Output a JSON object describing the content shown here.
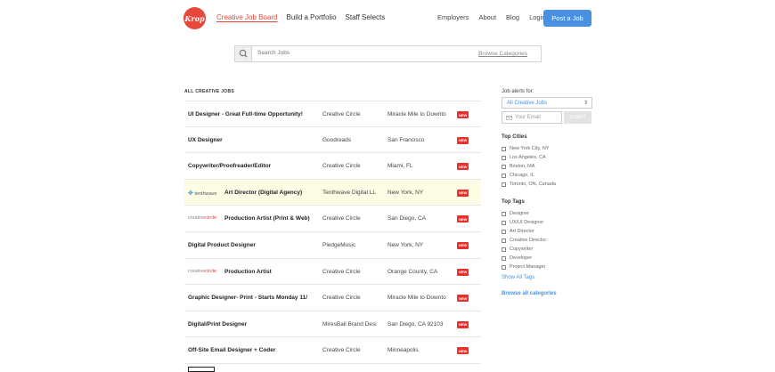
{
  "header": {
    "logo_text": "Krop",
    "nav_left": [
      "Creative Job Board",
      "Build a Portfolio",
      "Staff Selects"
    ],
    "nav_right": [
      "Employers",
      "About",
      "Blog",
      "Login"
    ],
    "post_button": "Post a Job"
  },
  "search": {
    "placeholder": "Search Jobs",
    "browse_label": "Browse Categories"
  },
  "jobs_section_title": "ALL CREATIVE JOBS",
  "jobs": [
    {
      "title": "UI Designer - Great Full-time Opportunity!",
      "company": "Creative Circle",
      "location": "Miracle Mile to Downto",
      "badge": "NEW"
    },
    {
      "title": "UX Designer",
      "company": "Goodreads",
      "location": "San Francisco",
      "badge": "NEW"
    },
    {
      "title": "Copywriter/Proofreader/Editor",
      "company": "Creative Circle",
      "location": "Miami, FL",
      "badge": "NEW"
    },
    {
      "title": "Art Director (Digital Agency)",
      "company": "Tenthwave Digital LL",
      "location": "New York, NY",
      "badge": "NEW",
      "logo": "tenthwave"
    },
    {
      "title": "Production Artist (Print & Web)",
      "company": "Creative Circle",
      "location": "San Diego, CA",
      "badge": "NEW",
      "logo": "creativecircle"
    },
    {
      "title": "Digital Product Designer",
      "company": "PledgeMusic",
      "location": "New York, NY",
      "badge": "NEW"
    },
    {
      "title": "Production Artist",
      "company": "Creative Circle",
      "location": "Orange County, CA",
      "badge": "NEW",
      "logo": "creativecircle"
    },
    {
      "title": "Graphic Designer- Print - Starts Monday 11/",
      "company": "Creative Circle",
      "location": "Miracle Mile to Downto",
      "badge": "NEW"
    },
    {
      "title": "Digital/Print Designer",
      "company": "MiresBall Brand Desi",
      "location": "San Diego, CA 92103",
      "badge": "NEW"
    },
    {
      "title": "Off-Site Email Designer + Coder",
      "company": "Creative Circle",
      "location": "Minneapolis",
      "badge": "NEW"
    }
  ],
  "logos": {
    "tenthwave": "tenthwave",
    "creative": "creative",
    "circle": "circle"
  },
  "sidebar": {
    "alerts_label": "Job alerts for:",
    "alert_select": "All Creative Jobs",
    "email_placeholder": "Your Email",
    "submit_label": "SUBMIT",
    "top_cities_heading": "Top Cities",
    "cities": [
      "New York City, NY",
      "Los Angeles, CA",
      "Boston, MA",
      "Chicago, IL",
      "Toronto, ON, Canada"
    ],
    "top_tags_heading": "Top Tags",
    "tags": [
      "Designer",
      "UX/UI Designer",
      "Art Director",
      "Creative Director",
      "Copywriter",
      "Developer",
      "Project Manager"
    ],
    "show_all_tags": "Show All Tags",
    "browse_all": "Browse all categories"
  },
  "colors": {
    "brand_red": "#e8473b",
    "accent_blue": "#4a90e2",
    "featured_bg": "#fdfde6"
  }
}
